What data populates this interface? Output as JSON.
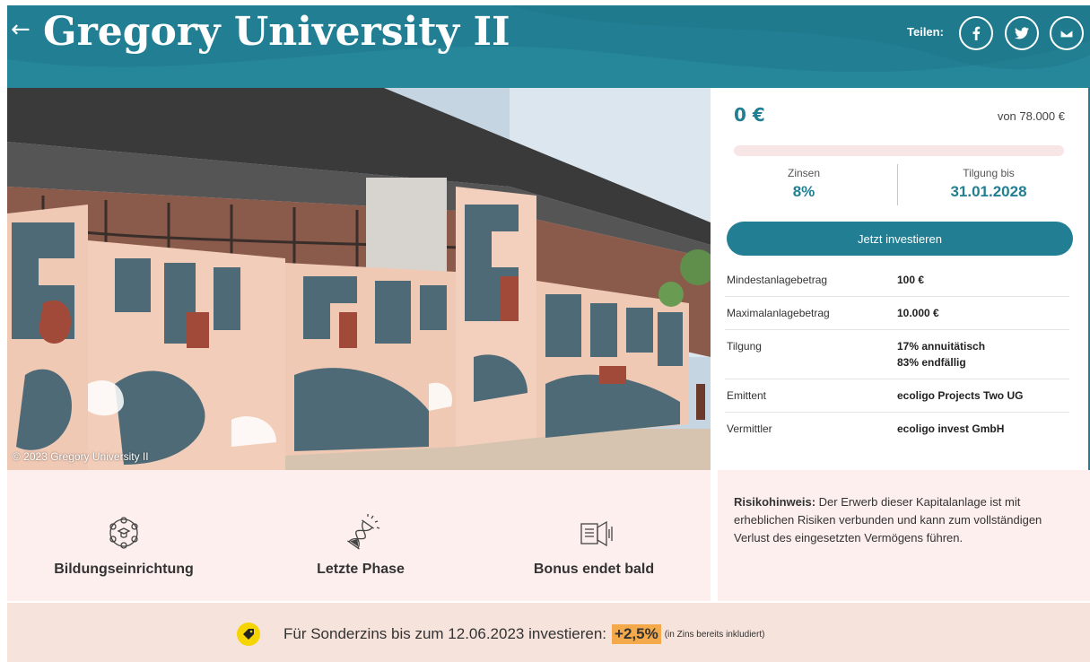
{
  "header": {
    "back_symbol": "←",
    "title": "Gregory University II",
    "share_label": "Teilen:",
    "share_buttons": [
      {
        "icon": "facebook-icon",
        "label": "f"
      },
      {
        "icon": "twitter-icon",
        "label": ""
      },
      {
        "icon": "email-icon",
        "label": ""
      }
    ],
    "brand_color": "#227f93"
  },
  "photo": {
    "credit": "© 2023 Gregory University II"
  },
  "invest": {
    "amount": "0 €",
    "goal": "von 78.000 €",
    "progress": 0,
    "interest_label": "Zinsen",
    "interest_value": "8%",
    "repayment_label": "Tilgung bis",
    "repayment_value": "31.01.2028",
    "cta_label": "Jetzt investieren",
    "terms": [
      {
        "key": "Mindestanlagebetrag",
        "value": "100 €"
      },
      {
        "key": "Maximalanlagebetrag",
        "value": "10.000 €"
      },
      {
        "key": "Tilgung",
        "value": "17% annuitätisch",
        "value2": "83% endfällig"
      },
      {
        "key": "Emittent",
        "value": "ecoligo Projects Two UG"
      },
      {
        "key": "Vermittler",
        "value": "ecoligo invest GmbH"
      }
    ]
  },
  "features": [
    {
      "icon": "education-icon",
      "label": "Bildungseinrichtung"
    },
    {
      "icon": "hourglass-icon",
      "label": "Letzte Phase"
    },
    {
      "icon": "megaphone-icon",
      "label": "Bonus endet bald"
    }
  ],
  "risk": {
    "title": "Risikohinweis:",
    "text": " Der Erwerb dieser Kapitalanlage ist mit erheblichen Risiken verbunden und kann zum vollständigen Verlust des eingesetzten Vermögens führen."
  },
  "bonus": {
    "text": "Für Sonderzins bis zum 12.06.2023 investieren:",
    "rate": "+2,5%",
    "note": "(in Zins bereits inkludiert)"
  }
}
